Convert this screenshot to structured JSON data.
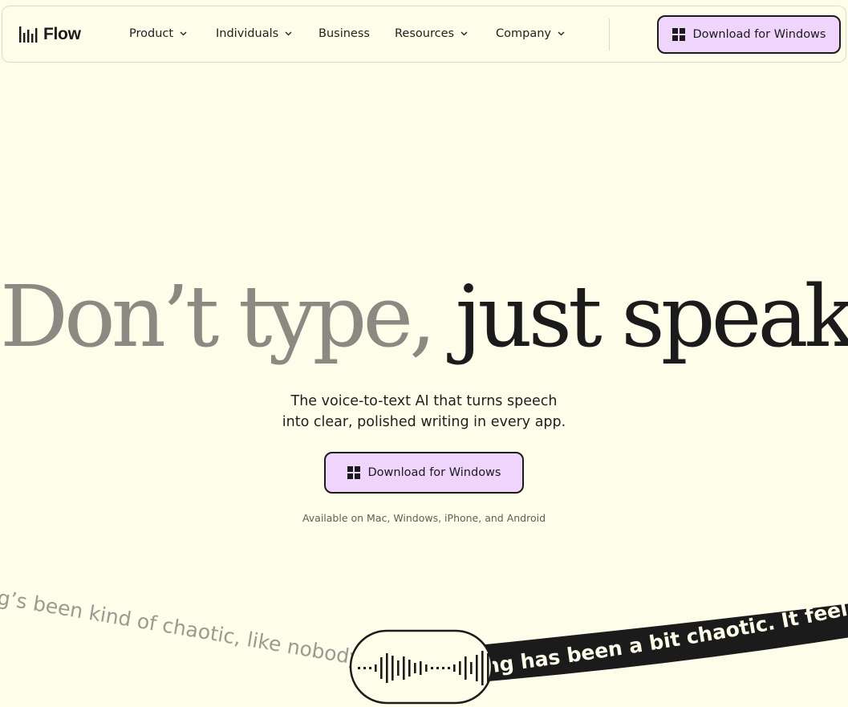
{
  "nav": {
    "logo_text": "Flow",
    "logo_icon": "audio-bars-icon",
    "items": [
      {
        "label": "Product",
        "has_dropdown": true
      },
      {
        "label": "Individuals",
        "has_dropdown": true
      },
      {
        "label": "Business",
        "has_dropdown": false
      },
      {
        "label": "Resources",
        "has_dropdown": true
      },
      {
        "label": "Company",
        "has_dropdown": true
      }
    ],
    "download_label": "Download for Windows",
    "download_icon": "windows-icon"
  },
  "hero": {
    "title_light": "Don’t type,",
    "title_dark": "just speak",
    "subtitle_line1": "The voice-to-text AI that turns speech",
    "subtitle_line2": "into clear, polished writing in every app.",
    "download_label": "Download for Windows",
    "available": "Available on Mac, Windows, iPhone, and Android"
  },
  "demo": {
    "raw_text": "ng’s been kind of chaotic, like nobody",
    "polished_text": "ng has been a bit chaotic. It feels lik",
    "waveform_icon": "waveform-icon"
  },
  "colors": {
    "background": "#FEFDE9",
    "accent": "#EFD5FB",
    "text_dark": "#1b1b1b",
    "text_light": "#8a8a82"
  }
}
